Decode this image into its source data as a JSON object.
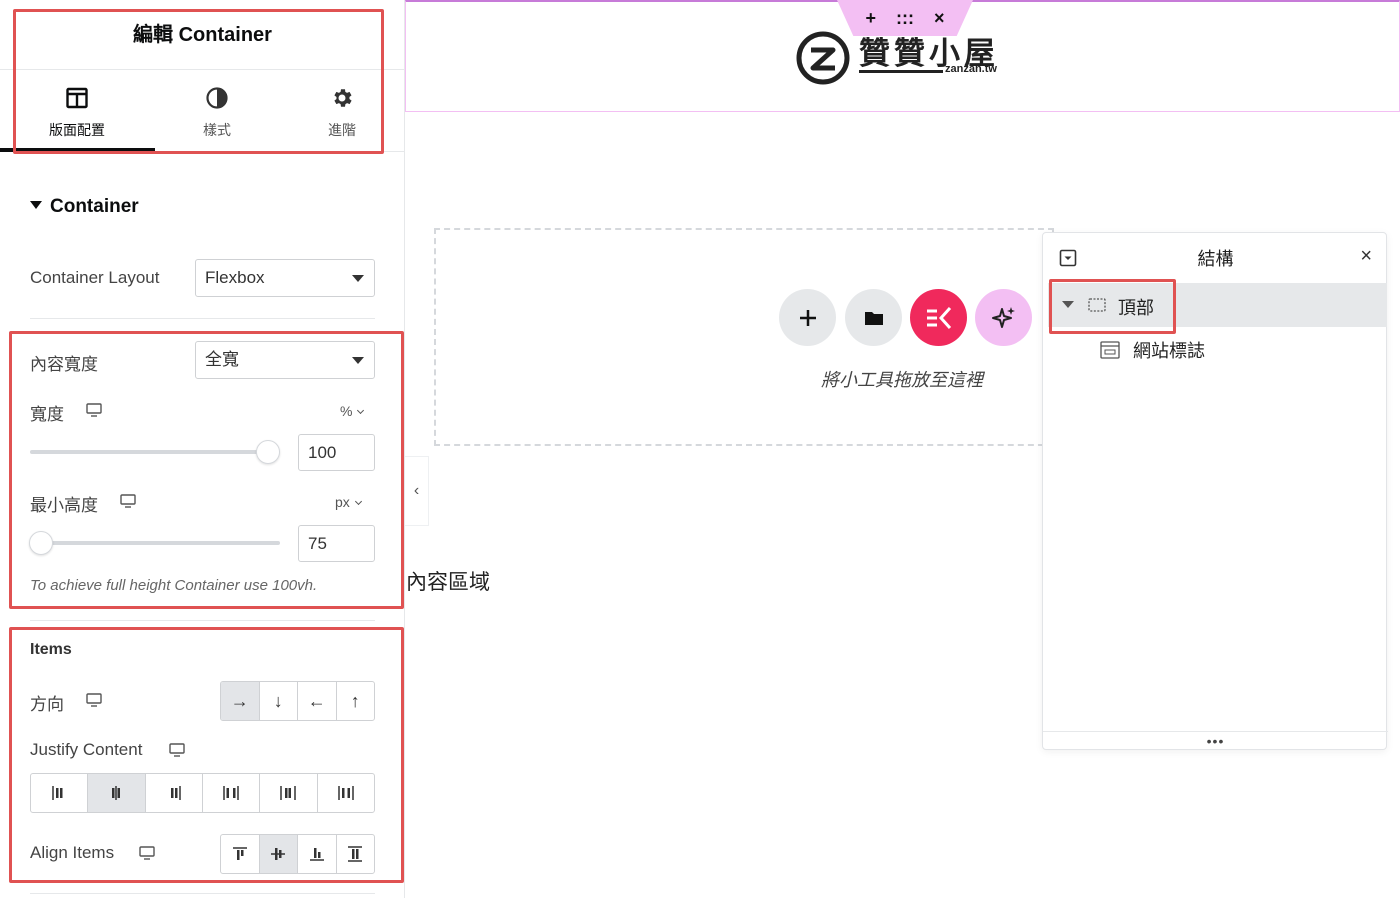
{
  "panel": {
    "title": "編輯 Container",
    "tabs": [
      {
        "label": "版面配置",
        "icon": "layout-icon",
        "active": true
      },
      {
        "label": "樣式",
        "icon": "half-circle-icon",
        "active": false
      },
      {
        "label": "進階",
        "icon": "gear-icon",
        "active": false
      }
    ],
    "section_title": "Container",
    "container_layout": {
      "label": "Container Layout",
      "value": "Flexbox"
    },
    "content_width": {
      "label": "內容寬度",
      "value": "全寬"
    },
    "width": {
      "label": "寬度",
      "unit": "%",
      "value": "100",
      "slider_fraction": 1.0
    },
    "min_height": {
      "label": "最小高度",
      "unit": "px",
      "value": "75",
      "slider_fraction": 0.0
    },
    "hint": "To achieve full height Container use 100vh.",
    "items_title": "Items",
    "direction": {
      "label": "方向",
      "options": [
        "→",
        "↓",
        "←",
        "↑"
      ],
      "selected": 0
    },
    "justify_content": {
      "label": "Justify Content",
      "options": [
        "start",
        "center",
        "end",
        "space-between",
        "space-around",
        "space-evenly"
      ],
      "selected": 1
    },
    "align_items": {
      "label": "Align Items",
      "options": [
        "start",
        "center",
        "end",
        "stretch"
      ],
      "selected": 1
    }
  },
  "canvas": {
    "header_handle": {
      "add": "+",
      "drag": ":::",
      "close": "×"
    },
    "logo": {
      "brand": "贊贊小屋",
      "domain": "zanzan.tw"
    },
    "dropzone_text": "將小工具拖放至這裡",
    "content_area_text": "內容區域",
    "collapse_icon": "‹"
  },
  "structure": {
    "title": "結構",
    "close": "×",
    "tree": [
      {
        "label": "頂部",
        "expanded": true
      },
      {
        "label": "網站標誌"
      }
    ],
    "footer_dots": "•••"
  },
  "colors": {
    "accent_red": "#e05252",
    "elementor_pink": "#f0295c",
    "ai_lilac": "#f3bff3",
    "header_outline": "#f3bff3"
  }
}
